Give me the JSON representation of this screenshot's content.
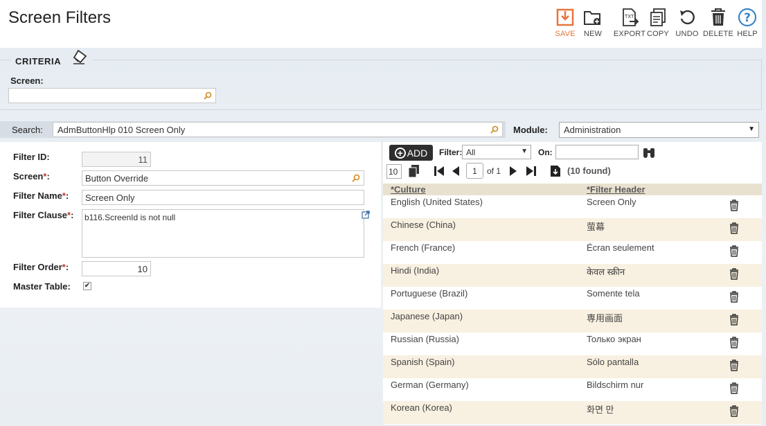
{
  "page": {
    "title": "Screen Filters"
  },
  "toolbar": {
    "save": "SAVE",
    "new": "NEW",
    "export": "EXPORT",
    "copy": "COPY",
    "undo": "UNDO",
    "delete": "DELETE",
    "help": "HELP",
    "export_badge": "TXT",
    "accent": "#e8743b",
    "help_color": "#3a86c8"
  },
  "criteria": {
    "legend": "CRITERIA",
    "screen_label": "Screen:",
    "screen_value": ""
  },
  "search": {
    "label": "Search:",
    "value": "AdmButtonHlp 010 Screen Only"
  },
  "module": {
    "label": "Module:",
    "value": "Administration"
  },
  "form": {
    "filter_id_label": "Filter ID:",
    "filter_id": "11",
    "screen_label": "Screen",
    "screen_value": "Button Override",
    "filter_name_label": "Filter Name",
    "filter_name": "Screen Only",
    "filter_clause_label": "Filter Clause",
    "filter_clause": "b116.ScreenId is not null",
    "filter_order_label": "Filter Order",
    "filter_order": "10",
    "master_table_label": "Master Table:",
    "master_table_checked": true,
    "required_mark": "*",
    "colon": ":"
  },
  "grid": {
    "add_label": "ADD",
    "filter_label": "Filter:",
    "filter_value": "All",
    "on_label": "On:",
    "on_value": "",
    "page_size": "10",
    "page": "1",
    "of_label": "of 1",
    "found": "(10 found)",
    "columns": [
      "*Culture",
      "*Filter Header"
    ],
    "rows": [
      {
        "culture": "English (United States)",
        "header": "Screen Only"
      },
      {
        "culture": "Chinese (China)",
        "header": "萤幕"
      },
      {
        "culture": "French (France)",
        "header": "Écran seulement"
      },
      {
        "culture": "Hindi (India)",
        "header": "केवल स्क्रीन"
      },
      {
        "culture": "Portuguese (Brazil)",
        "header": "Somente tela"
      },
      {
        "culture": "Japanese (Japan)",
        "header": "専用画面"
      },
      {
        "culture": "Russian (Russia)",
        "header": "Только экран"
      },
      {
        "culture": "Spanish (Spain)",
        "header": "Sólo pantalla"
      },
      {
        "culture": "German (Germany)",
        "header": "Bildschirm nur"
      },
      {
        "culture": "Korean (Korea)",
        "header": "화면 만"
      }
    ]
  }
}
